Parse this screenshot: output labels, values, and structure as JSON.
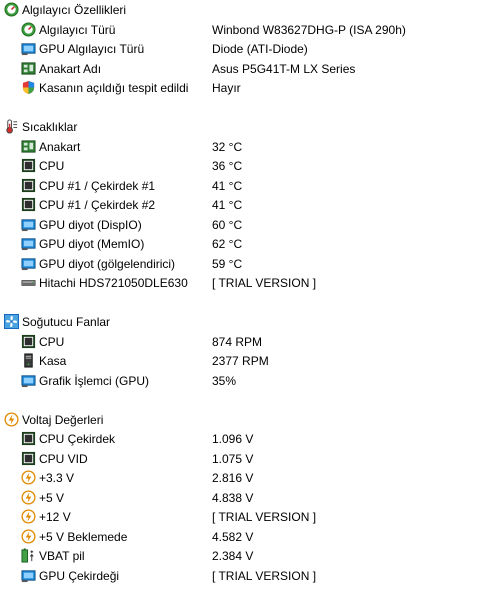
{
  "sensor_props": {
    "title": "Algılayıcı Özellikleri",
    "items": [
      {
        "label": "Algılayıcı Türü",
        "value": "Winbond W83627DHG-P  (ISA 290h)"
      },
      {
        "label": "GPU Algılayıcı Türü",
        "value": "Diode  (ATI-Diode)"
      },
      {
        "label": "Anakart Adı",
        "value": "Asus P5G41T-M LX Series"
      },
      {
        "label": "Kasanın açıldığı tespit edildi",
        "value": "Hayır"
      }
    ]
  },
  "temps": {
    "title": "Sıcaklıklar",
    "items": [
      {
        "label": "Anakart",
        "value": "32 °C"
      },
      {
        "label": "CPU",
        "value": "36 °C"
      },
      {
        "label": "CPU #1 / Çekirdek #1",
        "value": "41 °C"
      },
      {
        "label": "CPU #1 / Çekirdek #2",
        "value": "41 °C"
      },
      {
        "label": "GPU diyot (DispIO)",
        "value": "60 °C"
      },
      {
        "label": "GPU diyot (MemIO)",
        "value": "62 °C"
      },
      {
        "label": "GPU diyot (gölgelendirici)",
        "value": "59 °C"
      },
      {
        "label": "Hitachi HDS721050DLE630",
        "value": "[ TRIAL VERSION ]"
      }
    ]
  },
  "fans": {
    "title": "Soğutucu Fanlar",
    "items": [
      {
        "label": "CPU",
        "value": "874 RPM"
      },
      {
        "label": "Kasa",
        "value": "2377 RPM"
      },
      {
        "label": "Grafik İşlemci (GPU)",
        "value": "35%"
      }
    ]
  },
  "volts": {
    "title": "Voltaj Değerleri",
    "items": [
      {
        "label": "CPU Çekirdek",
        "value": "1.096 V"
      },
      {
        "label": "CPU VID",
        "value": "1.075 V"
      },
      {
        "label": "+3.3 V",
        "value": "2.816 V"
      },
      {
        "label": "+5 V",
        "value": "4.838 V"
      },
      {
        "label": "+12 V",
        "value": "[ TRIAL VERSION ]"
      },
      {
        "label": "+5 V Beklemede",
        "value": "4.582 V"
      },
      {
        "label": "VBAT pil",
        "value": "2.384 V"
      },
      {
        "label": "GPU Çekirdeği",
        "value": "[ TRIAL VERSION ]"
      }
    ]
  },
  "colors": {
    "accent_blue": "#1e88d6",
    "chip_green": "#2e7d32",
    "volt_orange": "#e08a00"
  }
}
